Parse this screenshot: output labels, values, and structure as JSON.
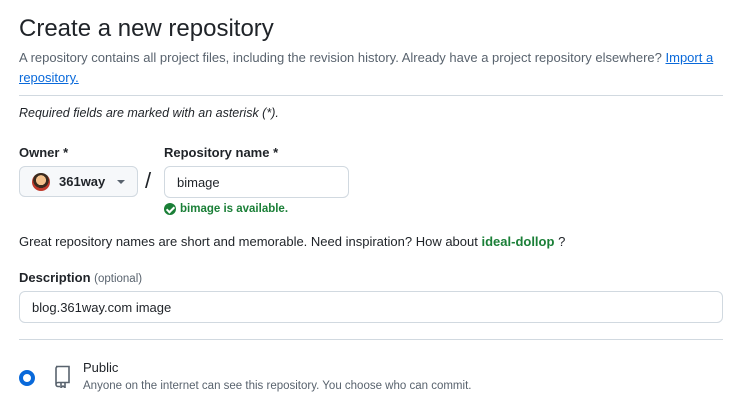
{
  "page": {
    "title": "Create a new repository",
    "intro_text": "A repository contains all project files, including the revision history. Already have a project repository elsewhere?",
    "import_link": "Import a repository."
  },
  "form": {
    "required_note": "Required fields are marked with an asterisk (*).",
    "owner": {
      "label": "Owner *",
      "value": "361way"
    },
    "separator": "/",
    "repo_name": {
      "label": "Repository name *",
      "value": "bimage"
    },
    "availability": "bimage is available.",
    "inspiration": {
      "text": "Great repository names are short and memorable. Need inspiration? How about",
      "suggestion": "ideal-dollop",
      "suffix": "?"
    },
    "description": {
      "label": "Description",
      "optional": "(optional)",
      "value": "blog.361way.com image"
    },
    "visibility": {
      "public_label": "Public",
      "public_desc": "Anyone on the internet can see this repository. You choose who can commit.",
      "selected": "public"
    }
  },
  "colors": {
    "accent": "#0969da",
    "success": "#1a7f37",
    "text": "#1f2328",
    "muted": "#59636e",
    "border": "#d1d9e0"
  }
}
